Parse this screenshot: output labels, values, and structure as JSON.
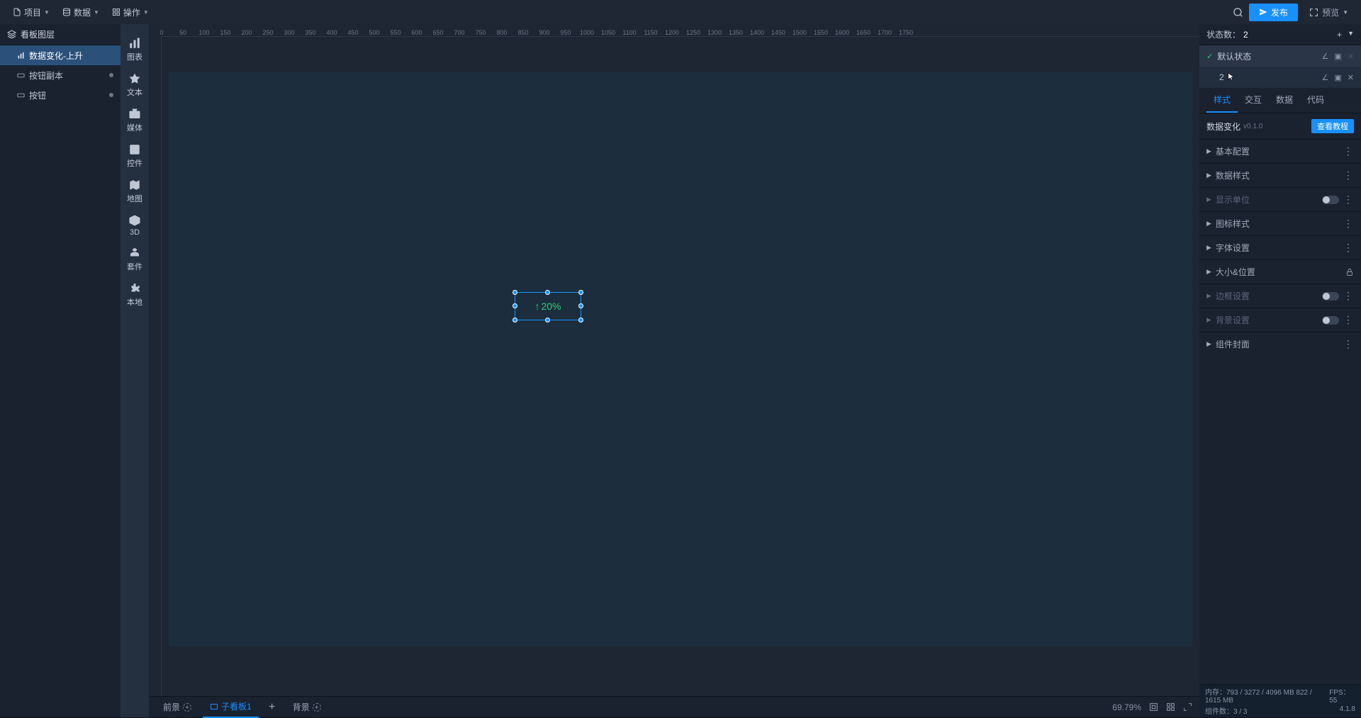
{
  "top_menu": {
    "project": "项目",
    "data": "数据",
    "operate": "操作"
  },
  "top_actions": {
    "publish": "发布",
    "preview": "预览"
  },
  "left_panel": {
    "title": "看板图层",
    "items": [
      {
        "label": "数据变化-上升",
        "selected": true
      },
      {
        "label": "按钮副本",
        "dotted": true
      },
      {
        "label": "按钮",
        "dotted": true
      }
    ]
  },
  "toolbar": [
    {
      "label": "图表"
    },
    {
      "label": "文本"
    },
    {
      "label": "媒体"
    },
    {
      "label": "控件"
    },
    {
      "label": "地图"
    },
    {
      "label": "3D"
    },
    {
      "label": "套件"
    },
    {
      "label": "本地"
    }
  ],
  "canvas_widget": {
    "value": "20%"
  },
  "ruler_h": [
    "0",
    "50",
    "100",
    "150",
    "200",
    "250",
    "300",
    "350",
    "400",
    "450",
    "500",
    "550",
    "600",
    "650",
    "700",
    "750",
    "800",
    "850",
    "900",
    "950",
    "1000",
    "1050",
    "1100",
    "1150",
    "1200",
    "1250",
    "1300",
    "1350",
    "1400",
    "1450",
    "1500",
    "1550",
    "1600",
    "1650",
    "1700",
    "1750"
  ],
  "bottom": {
    "foreground": "前景",
    "sub_board": "子看板1",
    "background": "背景",
    "zoom": "69.79%"
  },
  "right_panel": {
    "state_count_label": "状态数：",
    "state_count": "2",
    "states": [
      {
        "label": "默认状态",
        "default": true
      },
      {
        "label": "2"
      }
    ],
    "tabs": [
      "样式",
      "交互",
      "数据",
      "代码"
    ],
    "component_name": "数据变化",
    "component_version": "v0.1.0",
    "tutorial": "查看教程",
    "sections": [
      {
        "label": "基本配置",
        "more": true
      },
      {
        "label": "数据样式",
        "more": true
      },
      {
        "label": "显示单位",
        "toggle": true,
        "disabled": true
      },
      {
        "label": "图标样式",
        "more": true
      },
      {
        "label": "字体设置",
        "more": true
      },
      {
        "label": "大小&位置",
        "lock": true
      },
      {
        "label": "边框设置",
        "toggle": true,
        "disabled": true
      },
      {
        "label": "背景设置",
        "toggle": true,
        "disabled": true
      },
      {
        "label": "组件封面",
        "more": true
      }
    ]
  },
  "status": {
    "mem_label": "内存：",
    "mem": "793 / 3272 / 4096 MB  822 / 1615 MB",
    "fps_label": "FPS：",
    "fps": "55",
    "comp_label": "组件数：",
    "comp": "3 / 3",
    "ver": "4.1.8"
  }
}
